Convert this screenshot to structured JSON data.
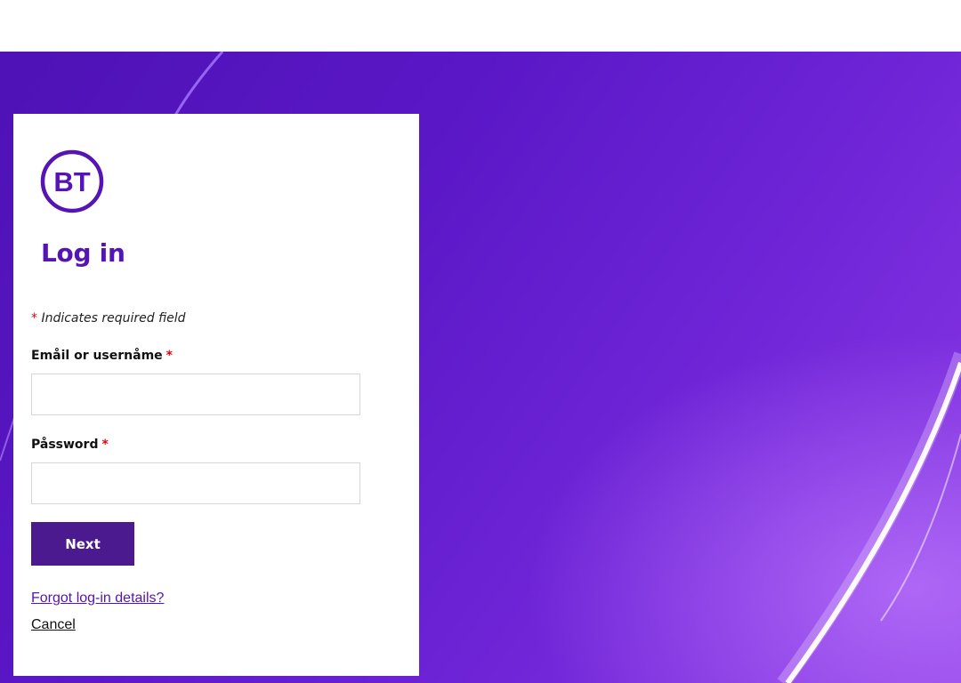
{
  "brand": {
    "logo_text": "BT",
    "logo_color": "#5514b4",
    "icon": "bt-logo-icon"
  },
  "page": {
    "title": "Log in",
    "background_color": "#5a17c6"
  },
  "form": {
    "required_star": "*",
    "required_note": "Indicates required field",
    "email_label": "Emåil or usernåme",
    "email_value": "",
    "password_label": "Påssword",
    "password_value": "",
    "next_label": "Next",
    "next_color": "#4b1a8f",
    "required_color": "#e60014"
  },
  "links": {
    "forgot": "Forgot log-in details?",
    "cancel": "Cancel"
  }
}
